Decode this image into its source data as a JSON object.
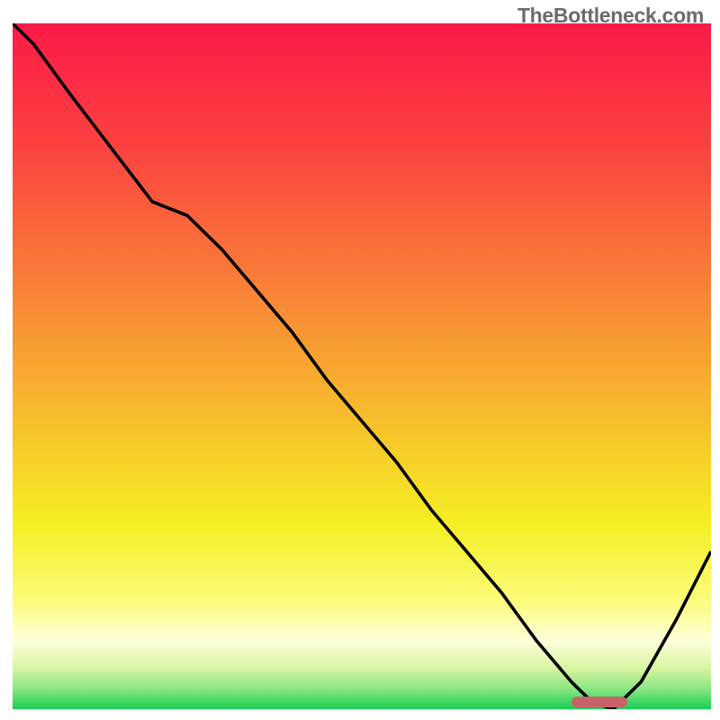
{
  "watermark": "TheBottleneck.com",
  "chart_data": {
    "type": "line",
    "title": "",
    "xlabel": "",
    "ylabel": "",
    "xlim": [
      0,
      100
    ],
    "ylim": [
      0,
      100
    ],
    "x": [
      0,
      3,
      8,
      14,
      20,
      25,
      30,
      35,
      40,
      45,
      50,
      55,
      60,
      65,
      70,
      75,
      80,
      83,
      86,
      90,
      95,
      100
    ],
    "values": [
      100,
      97,
      90,
      82,
      74,
      72,
      67,
      61,
      55,
      48,
      42,
      36,
      29,
      23,
      17,
      10,
      4,
      1,
      0,
      4,
      13,
      23
    ],
    "annotations": [
      {
        "kind": "optimal_range",
        "x_start": 80,
        "x_end": 88,
        "y": 1
      }
    ],
    "colors": {
      "curve": "#000000",
      "marker": "#c96168",
      "gradient_stops": [
        {
          "pos": 0.0,
          "hex": "#fc1a47"
        },
        {
          "pos": 0.18,
          "hex": "#fb4240"
        },
        {
          "pos": 0.38,
          "hex": "#f98037"
        },
        {
          "pos": 0.58,
          "hex": "#f7bf2c"
        },
        {
          "pos": 0.73,
          "hex": "#f5ef24"
        },
        {
          "pos": 0.84,
          "hex": "#fbfc78"
        },
        {
          "pos": 0.9,
          "hex": "#feffda"
        },
        {
          "pos": 0.94,
          "hex": "#d9f5a3"
        },
        {
          "pos": 0.97,
          "hex": "#8be583"
        },
        {
          "pos": 1.0,
          "hex": "#17cf54"
        }
      ]
    }
  }
}
